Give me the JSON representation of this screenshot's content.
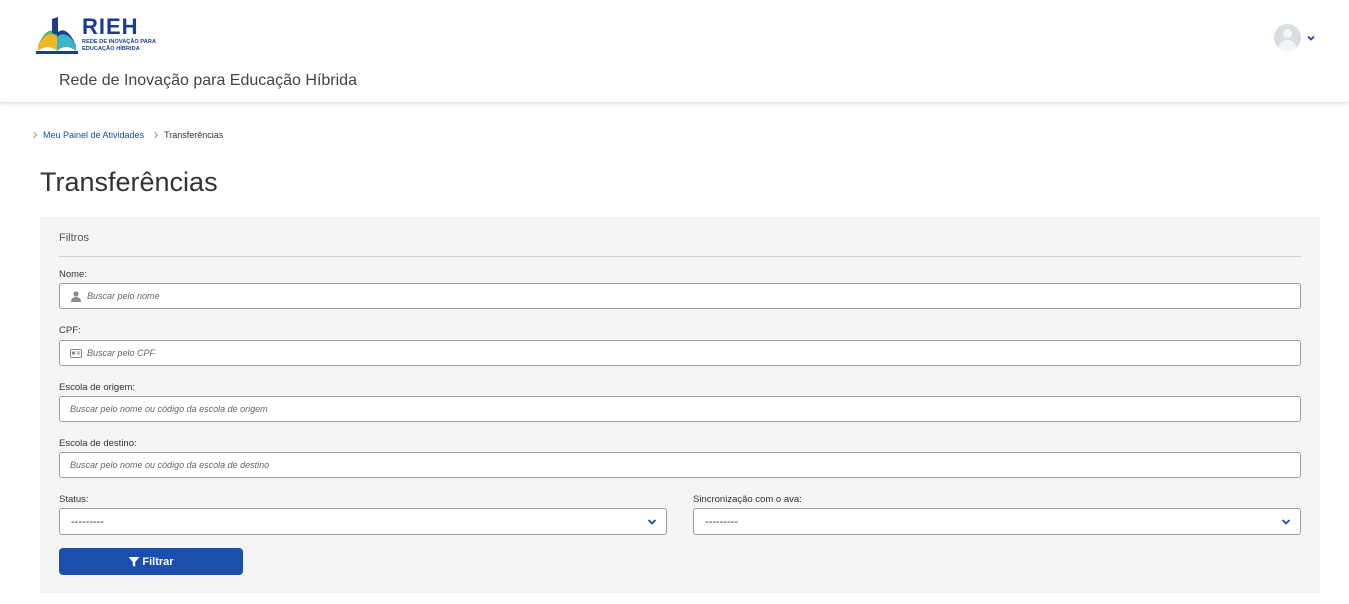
{
  "brand": {
    "abbr": "RIEH",
    "subline1": "REDE DE INOVAÇÃO PARA",
    "subline2": "EDUCAÇÃO HÍBRIDA",
    "site_name": "Rede de Inovação para Educação Híbrida",
    "colors": {
      "primary": "#1a3d8f",
      "accent_yellow": "#f2b823",
      "accent_green": "#5cb85c",
      "accent_cyan": "#3bb6c9"
    }
  },
  "user_menu": {
    "icon": "avatar-icon",
    "caret_icon": "chevron-down-icon"
  },
  "breadcrumb": {
    "items": [
      {
        "label": "Meu Painel de Atividades"
      },
      {
        "label": "Transferências"
      }
    ]
  },
  "page": {
    "title": "Transferências"
  },
  "filters": {
    "legend": "Filtros",
    "nome": {
      "label": "Nome:",
      "placeholder": "Buscar pelo nome",
      "icon": "user-icon"
    },
    "cpf": {
      "label": "CPF:",
      "placeholder": "Buscar pelo CPF",
      "icon": "id-card-icon"
    },
    "escola_origem": {
      "label": "Escola de origem:",
      "placeholder": "Buscar pelo nome ou código da escola de origem"
    },
    "escola_destino": {
      "label": "Escola de destino:",
      "placeholder": "Buscar pelo nome ou código da escola de destino"
    },
    "status": {
      "label": "Status:",
      "selected": "---------"
    },
    "sync": {
      "label": "Sincronização com o ava:",
      "selected": "---------"
    },
    "submit": {
      "label": "Filtrar",
      "icon": "filter-icon",
      "color": "#1a4fb0"
    }
  }
}
